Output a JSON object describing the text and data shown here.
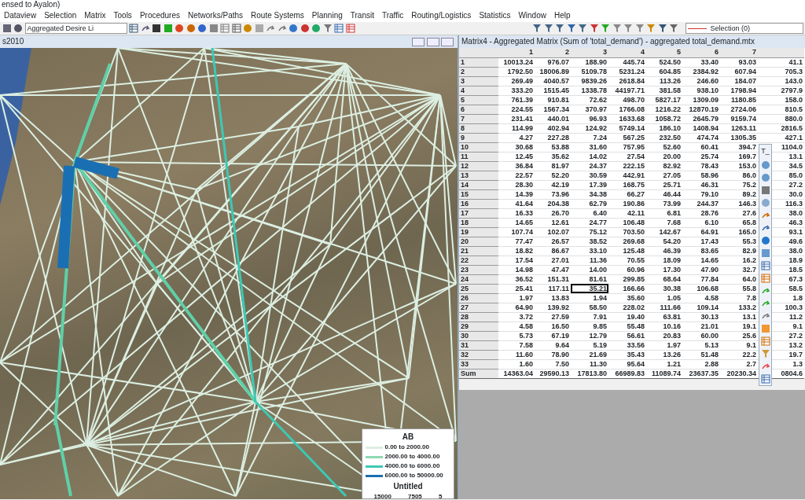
{
  "app_title": "ensed to Ayalon)",
  "menu": [
    "Dataview",
    "Selection",
    "Matrix",
    "Tools",
    "Procedures",
    "Networks/Paths",
    "Route Systems",
    "Planning",
    "Transit",
    "Traffic",
    "Routing/Logistics",
    "Statistics",
    "Window",
    "Help"
  ],
  "toolbar": {
    "layer_select": "Aggregated Desire Li",
    "selection_select": "Selection (0)"
  },
  "map_window": {
    "title": "s2010",
    "legend": {
      "title": "AB",
      "items": [
        {
          "label": "0.00 to 2000.00",
          "color": "#dcefe2"
        },
        {
          "label": "2000.00 to 4000.00",
          "color": "#8fd9b0"
        },
        {
          "label": "4000.00 to 6000.00",
          "color": "#3cc9b4"
        },
        {
          "label": "6000.00 to 50000.00",
          "color": "#1a6fb3"
        }
      ],
      "size_title": "Untitled",
      "size_labels": [
        "15000",
        "7505",
        "5"
      ]
    }
  },
  "matrix_window": {
    "title": "Matrix4 - Aggregated Matrix (Sum of 'total_demand') - aggregated total_demand.mtx",
    "columns": [
      "1",
      "2",
      "3",
      "4",
      "5",
      "6",
      "7"
    ],
    "rows": [
      {
        "label": "1",
        "cells": [
          "10013.24",
          "976.07",
          "188.90",
          "445.74",
          "524.50",
          "33.40",
          "93.03",
          "41.1"
        ]
      },
      {
        "label": "2",
        "cells": [
          "1792.50",
          "18006.89",
          "5109.78",
          "5231.24",
          "604.85",
          "2384.92",
          "607.94",
          "705.3"
        ]
      },
      {
        "label": "3",
        "cells": [
          "269.49",
          "4040.57",
          "9839.26",
          "2618.84",
          "113.26",
          "246.60",
          "184.07",
          "143.0"
        ]
      },
      {
        "label": "4",
        "cells": [
          "333.20",
          "1515.45",
          "1338.78",
          "44197.71",
          "381.58",
          "938.10",
          "1798.94",
          "2797.9"
        ]
      },
      {
        "label": "5",
        "cells": [
          "761.39",
          "910.81",
          "72.62",
          "498.70",
          "5827.17",
          "1309.09",
          "1180.85",
          "158.0"
        ]
      },
      {
        "label": "6",
        "cells": [
          "224.55",
          "1567.34",
          "370.97",
          "1766.08",
          "1216.22",
          "12870.19",
          "2724.06",
          "810.5"
        ]
      },
      {
        "label": "7",
        "cells": [
          "231.41",
          "440.01",
          "96.93",
          "1633.68",
          "1058.72",
          "2645.79",
          "9159.74",
          "880.0"
        ]
      },
      {
        "label": "8",
        "cells": [
          "114.99",
          "402.94",
          "124.92",
          "5749.14",
          "186.10",
          "1408.94",
          "1263.11",
          "2816.5"
        ]
      },
      {
        "label": "9",
        "cells": [
          "4.27",
          "227.28",
          "7.24",
          "567.25",
          "232.50",
          "474.74",
          "1305.35",
          "427.1"
        ]
      },
      {
        "label": "10",
        "cells": [
          "30.68",
          "53.88",
          "31.60",
          "757.95",
          "52.60",
          "60.41",
          "394.7",
          "1104.0"
        ]
      },
      {
        "label": "11",
        "cells": [
          "12.45",
          "35.62",
          "14.02",
          "27.54",
          "20.00",
          "25.74",
          "169.7",
          "13.1"
        ]
      },
      {
        "label": "12",
        "cells": [
          "36.84",
          "81.97",
          "24.37",
          "222.15",
          "82.92",
          "78.43",
          "153.0",
          "34.5"
        ]
      },
      {
        "label": "13",
        "cells": [
          "22.57",
          "52.20",
          "30.59",
          "442.91",
          "27.05",
          "58.96",
          "86.0",
          "85.0"
        ]
      },
      {
        "label": "14",
        "cells": [
          "28.30",
          "42.19",
          "17.39",
          "168.75",
          "25.71",
          "46.31",
          "75.2",
          "27.2"
        ]
      },
      {
        "label": "15",
        "cells": [
          "14.39",
          "73.96",
          "34.38",
          "66.27",
          "46.44",
          "79.10",
          "89.2",
          "30.0"
        ]
      },
      {
        "label": "16",
        "cells": [
          "41.64",
          "204.38",
          "62.79",
          "190.86",
          "73.99",
          "244.37",
          "146.3",
          "116.3"
        ]
      },
      {
        "label": "17",
        "cells": [
          "16.33",
          "26.70",
          "6.40",
          "42.11",
          "6.81",
          "28.76",
          "27.6",
          "38.0"
        ]
      },
      {
        "label": "18",
        "cells": [
          "14.65",
          "12.61",
          "24.77",
          "106.48",
          "7.68",
          "6.10",
          "65.8",
          "46.3"
        ]
      },
      {
        "label": "19",
        "cells": [
          "107.74",
          "102.07",
          "75.12",
          "703.50",
          "142.67",
          "64.91",
          "165.0",
          "93.1"
        ]
      },
      {
        "label": "20",
        "cells": [
          "77.47",
          "26.57",
          "38.52",
          "269.68",
          "54.20",
          "17.43",
          "55.3",
          "49.6"
        ]
      },
      {
        "label": "21",
        "cells": [
          "18.82",
          "86.67",
          "33.10",
          "125.48",
          "46.39",
          "83.65",
          "82.9",
          "38.0"
        ]
      },
      {
        "label": "22",
        "cells": [
          "17.54",
          "27.01",
          "11.36",
          "70.55",
          "18.09",
          "14.65",
          "16.2",
          "18.9"
        ]
      },
      {
        "label": "23",
        "cells": [
          "14.98",
          "47.47",
          "14.00",
          "60.96",
          "17.30",
          "47.90",
          "32.7",
          "18.5"
        ]
      },
      {
        "label": "24",
        "cells": [
          "36.52",
          "151.31",
          "81.61",
          "299.85",
          "68.64",
          "77.84",
          "64.0",
          "67.3"
        ]
      },
      {
        "label": "25",
        "cells": [
          "25.41",
          "117.11",
          {
            "text": "35.21",
            "selected": true
          },
          "166.66",
          "30.38",
          "106.68",
          "55.8",
          "58.5"
        ]
      },
      {
        "label": "26",
        "cells": [
          "1.97",
          "13.83",
          "1.94",
          "35.60",
          "1.05",
          "4.58",
          "7.8",
          "1.8"
        ]
      },
      {
        "label": "27",
        "cells": [
          "64.90",
          "139.92",
          "58.50",
          "228.02",
          "111.66",
          "109.14",
          "133.2",
          "100.3"
        ]
      },
      {
        "label": "28",
        "cells": [
          "3.72",
          "27.59",
          "7.91",
          "19.40",
          "63.81",
          "30.13",
          "13.1",
          "11.2"
        ]
      },
      {
        "label": "29",
        "cells": [
          "4.58",
          "16.50",
          "9.85",
          "55.48",
          "10.16",
          "21.01",
          "19.1",
          "9.1"
        ]
      },
      {
        "label": "30",
        "cells": [
          "5.73",
          "67.19",
          "12.79",
          "56.61",
          "20.83",
          "60.00",
          "25.6",
          "27.2"
        ]
      },
      {
        "label": "31",
        "cells": [
          "7.58",
          "9.64",
          "5.19",
          "33.56",
          "1.97",
          "5.13",
          "9.1",
          "13.2"
        ]
      },
      {
        "label": "32",
        "cells": [
          "11.60",
          "78.90",
          "21.69",
          "35.43",
          "13.26",
          "51.48",
          "22.2",
          "19.7"
        ]
      },
      {
        "label": "33",
        "cells": [
          "1.60",
          "7.50",
          "11.30",
          "95.64",
          "1.21",
          "2.88",
          "2.7",
          "1.3"
        ]
      }
    ],
    "sum": {
      "label": "Sum",
      "cells": [
        "14363.04",
        "29590.13",
        "17813.80",
        "66989.83",
        "11089.74",
        "23637.35",
        "20230.34",
        "0804.6"
      ]
    }
  },
  "tool_palette": {
    "title": "T_"
  }
}
